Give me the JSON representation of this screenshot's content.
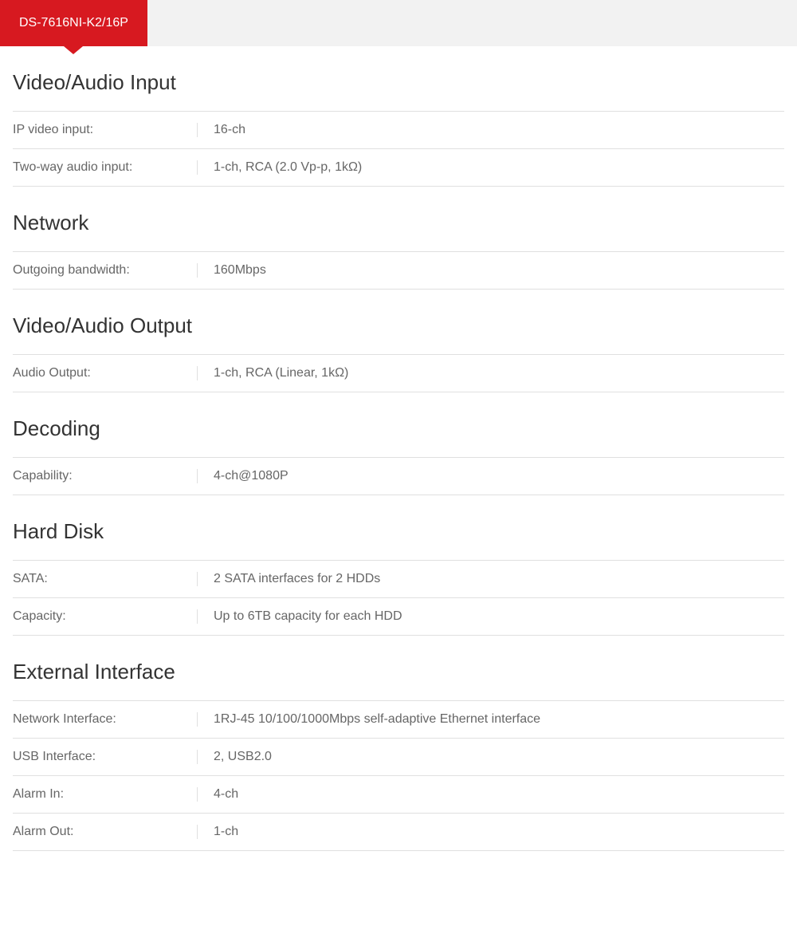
{
  "tab": {
    "label": "DS-7616NI-K2/16P"
  },
  "sections": {
    "video_audio_input": {
      "title": "Video/Audio Input",
      "ip_video_input_label": "IP video input:",
      "ip_video_input_value": "16-ch",
      "two_way_audio_label": "Two-way audio input:",
      "two_way_audio_value": "1-ch, RCA (2.0 Vp-p, 1kΩ)"
    },
    "network": {
      "title": "Network",
      "outgoing_bandwidth_label": "Outgoing bandwidth:",
      "outgoing_bandwidth_value": "160Mbps"
    },
    "video_audio_output": {
      "title": "Video/Audio Output",
      "audio_output_label": "Audio Output:",
      "audio_output_value": "1-ch, RCA (Linear, 1kΩ)"
    },
    "decoding": {
      "title": "Decoding",
      "capability_label": "Capability:",
      "capability_value": "4-ch@1080P"
    },
    "hard_disk": {
      "title": "Hard Disk",
      "sata_label": "SATA:",
      "sata_value": "2 SATA interfaces for 2 HDDs",
      "capacity_label": "Capacity:",
      "capacity_value": "Up to 6TB capacity for each HDD"
    },
    "external_interface": {
      "title": "External Interface",
      "network_interface_label": "Network Interface:",
      "network_interface_value": "1RJ-45 10/100/1000Mbps self-adaptive Ethernet interface",
      "usb_interface_label": "USB Interface:",
      "usb_interface_value": "2, USB2.0",
      "alarm_in_label": "Alarm In:",
      "alarm_in_value": "4-ch",
      "alarm_out_label": "Alarm Out:",
      "alarm_out_value": "1-ch"
    }
  }
}
